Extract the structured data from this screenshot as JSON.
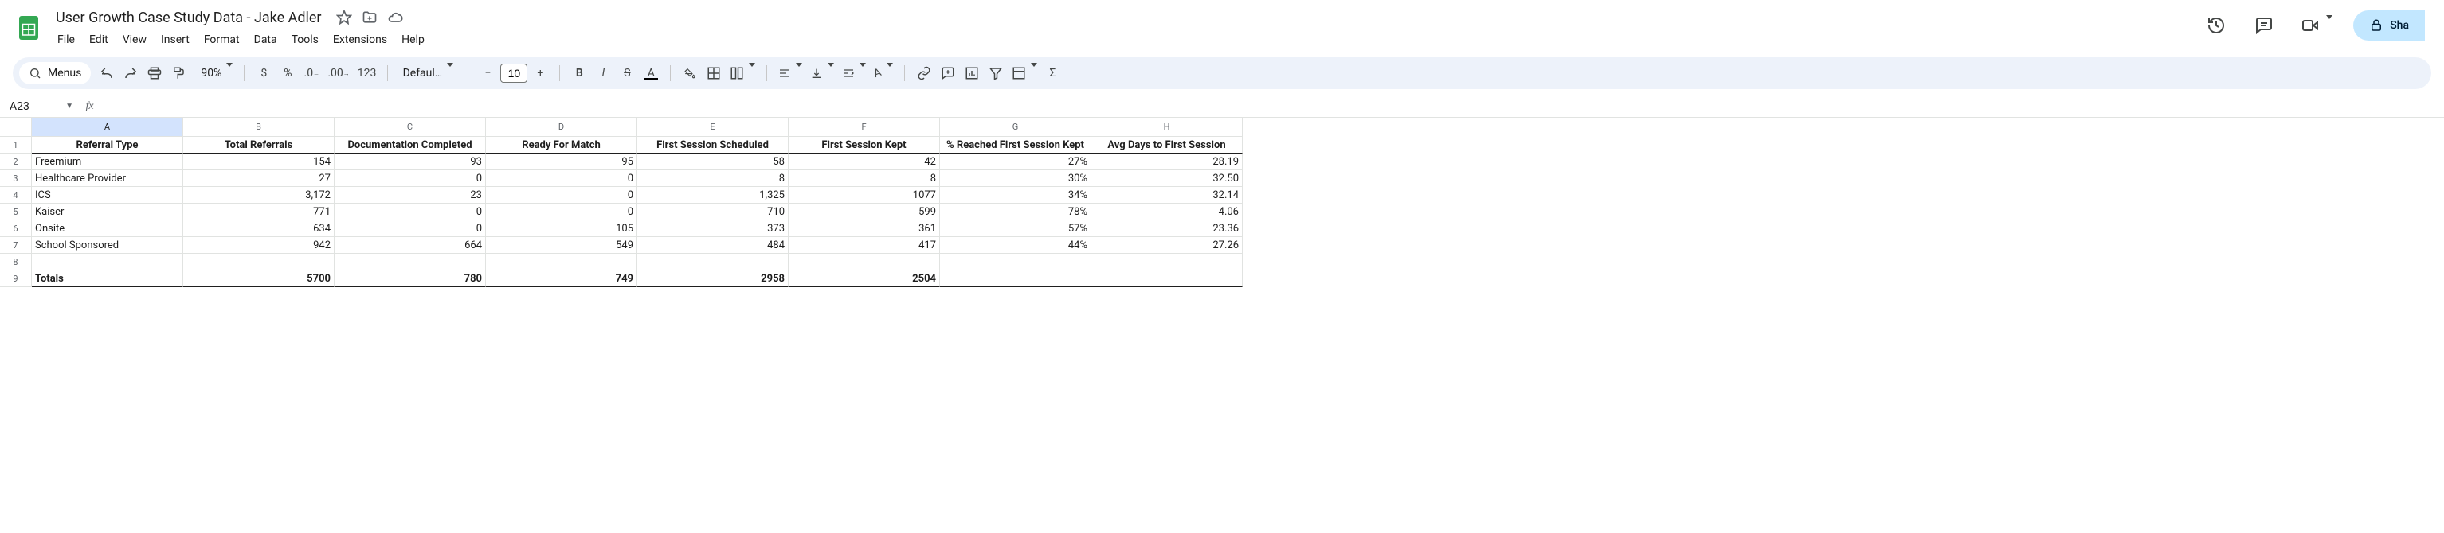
{
  "doc": {
    "title": "User Growth Case Study Data - Jake Adler"
  },
  "menus": [
    "File",
    "Edit",
    "View",
    "Insert",
    "Format",
    "Data",
    "Tools",
    "Extensions",
    "Help"
  ],
  "toolbar": {
    "menus_label": "Menus",
    "zoom": "90%",
    "font": "Defaul…",
    "font_size": "10",
    "number_tip": "123"
  },
  "share_label": "Sha",
  "namebox": "A23",
  "grid": {
    "columns": [
      "A",
      "B",
      "C",
      "D",
      "E",
      "F",
      "G",
      "H"
    ],
    "headers": [
      "Referral Type",
      "Total Referrals",
      "Documentation Completed",
      "Ready For Match",
      "First Session Scheduled",
      "First Session Kept",
      "% Reached First Session Kept",
      "Avg Days to First Session"
    ],
    "rows": [
      {
        "label": "Freemium",
        "vals": [
          "154",
          "93",
          "95",
          "58",
          "42",
          "27%",
          "28.19"
        ]
      },
      {
        "label": "Healthcare Provider",
        "vals": [
          "27",
          "0",
          "0",
          "8",
          "8",
          "30%",
          "32.50"
        ]
      },
      {
        "label": "ICS",
        "vals": [
          "3,172",
          "23",
          "0",
          "1,325",
          "1077",
          "34%",
          "32.14"
        ]
      },
      {
        "label": "Kaiser",
        "vals": [
          "771",
          "0",
          "0",
          "710",
          "599",
          "78%",
          "4.06"
        ]
      },
      {
        "label": "Onsite",
        "vals": [
          "634",
          "0",
          "105",
          "373",
          "361",
          "57%",
          "23.36"
        ]
      },
      {
        "label": "School Sponsored",
        "vals": [
          "942",
          "664",
          "549",
          "484",
          "417",
          "44%",
          "27.26"
        ]
      }
    ],
    "totals": {
      "label": "Totals",
      "vals": [
        "5700",
        "780",
        "749",
        "2958",
        "2504",
        "",
        ""
      ]
    }
  }
}
